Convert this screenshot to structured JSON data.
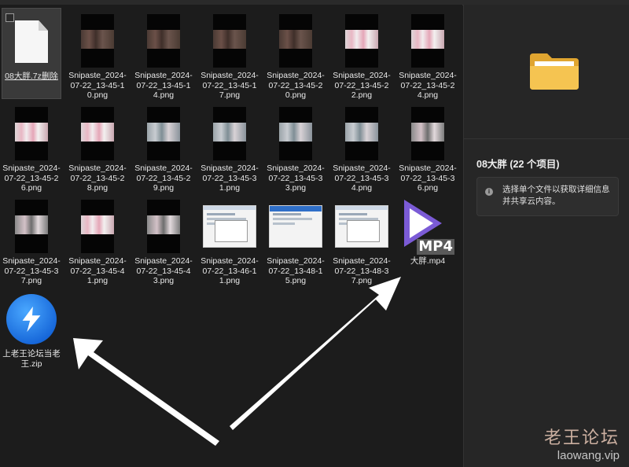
{
  "files": [
    {
      "name": "08大胖.7z删除",
      "thumb": "doc",
      "selected": true
    },
    {
      "name": "Snipaste_2024-07-22_13-45-10.png",
      "thumb": "murky"
    },
    {
      "name": "Snipaste_2024-07-22_13-45-14.png",
      "thumb": "murky"
    },
    {
      "name": "Snipaste_2024-07-22_13-45-17.png",
      "thumb": "murky"
    },
    {
      "name": "Snipaste_2024-07-22_13-45-20.png",
      "thumb": "murky"
    },
    {
      "name": "Snipaste_2024-07-22_13-45-22.png",
      "thumb": "bright"
    },
    {
      "name": "Snipaste_2024-07-22_13-45-24.png",
      "thumb": "bright"
    },
    {
      "name": "Snipaste_2024-07-22_13-45-26.png",
      "thumb": "bright"
    },
    {
      "name": "Snipaste_2024-07-22_13-45-28.png",
      "thumb": "bright"
    },
    {
      "name": "Snipaste_2024-07-22_13-45-29.png",
      "thumb": "cool"
    },
    {
      "name": "Snipaste_2024-07-22_13-45-31.png",
      "thumb": "cool"
    },
    {
      "name": "Snipaste_2024-07-22_13-45-33.png",
      "thumb": "cool"
    },
    {
      "name": "Snipaste_2024-07-22_13-45-34.png",
      "thumb": "cool"
    },
    {
      "name": "Snipaste_2024-07-22_13-45-36.png",
      "thumb": "mixed"
    },
    {
      "name": "Snipaste_2024-07-22_13-45-37.png",
      "thumb": "mixed"
    },
    {
      "name": "Snipaste_2024-07-22_13-45-41.png",
      "thumb": "bright"
    },
    {
      "name": "Snipaste_2024-07-22_13-45-43.png",
      "thumb": "mixed"
    },
    {
      "name": "Snipaste_2024-07-22_13-46-11.png",
      "thumb": "shot"
    },
    {
      "name": "Snipaste_2024-07-22_13-48-15.png",
      "thumb": "shot-blue"
    },
    {
      "name": "Snipaste_2024-07-22_13-48-37.png",
      "thumb": "shot"
    },
    {
      "name": "大胖.mp4",
      "thumb": "mp4",
      "badge": "MP4"
    },
    {
      "name": "上老王论坛当老王.zip",
      "thumb": "zip"
    }
  ],
  "details": {
    "title": "08大胖 (22 个项目)",
    "info_text": "选择单个文件以获取详细信息并共享云内容。",
    "info_icon": "info-icon"
  },
  "watermark": {
    "text": "老王论坛",
    "url": "laowang.vip"
  },
  "colors": {
    "background": "#1c1c1c",
    "pane": "#262626",
    "selection": "#3a3a3a",
    "mp4_accent": "#7b5bd6",
    "zip_accent": "#1e7bf0"
  }
}
